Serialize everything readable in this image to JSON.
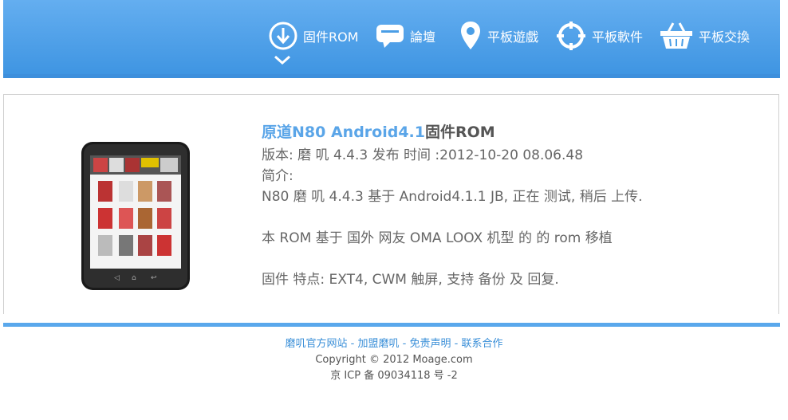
{
  "nav": {
    "items": [
      {
        "label": "固件ROM",
        "icon": "download-icon"
      },
      {
        "label": "論壇",
        "icon": "chat-bubble-icon"
      },
      {
        "label": "平板遊戲",
        "icon": "map-pin-icon"
      },
      {
        "label": "平板軟件",
        "icon": "crosshair-icon"
      },
      {
        "label": "平板交換",
        "icon": "basket-icon"
      }
    ]
  },
  "rom": {
    "title_name": "原道N80 Android4.1",
    "title_suffix": "固件ROM",
    "version_line": "版本: 磨 叽 4.4.3 发布 时间 :2012-10-20 08.06.48",
    "intro_label": "简介:",
    "desc1": "N80 磨 叽 4.4.3 基于 Android4.1.1 JB, 正在 测试, 稍后 上传.",
    "desc2": "本 ROM 基于 国外 网友 OMA LOOX 机型 的 的 rom 移植",
    "desc3": "固件 特点: EXT4, CWM 触屏, 支持 备份 及 回复."
  },
  "footer": {
    "links": [
      "磨叽官方网站",
      "加盟磨叽",
      "免责声明",
      "联系合作"
    ],
    "separator": " - ",
    "copyright": "Copyright © 2012 Moage.com",
    "icp": "京 ICP 备 09034118 号 -2"
  },
  "colors": {
    "header": "#4a9ee6",
    "accent": "#5aa5e8",
    "text": "#666666"
  }
}
